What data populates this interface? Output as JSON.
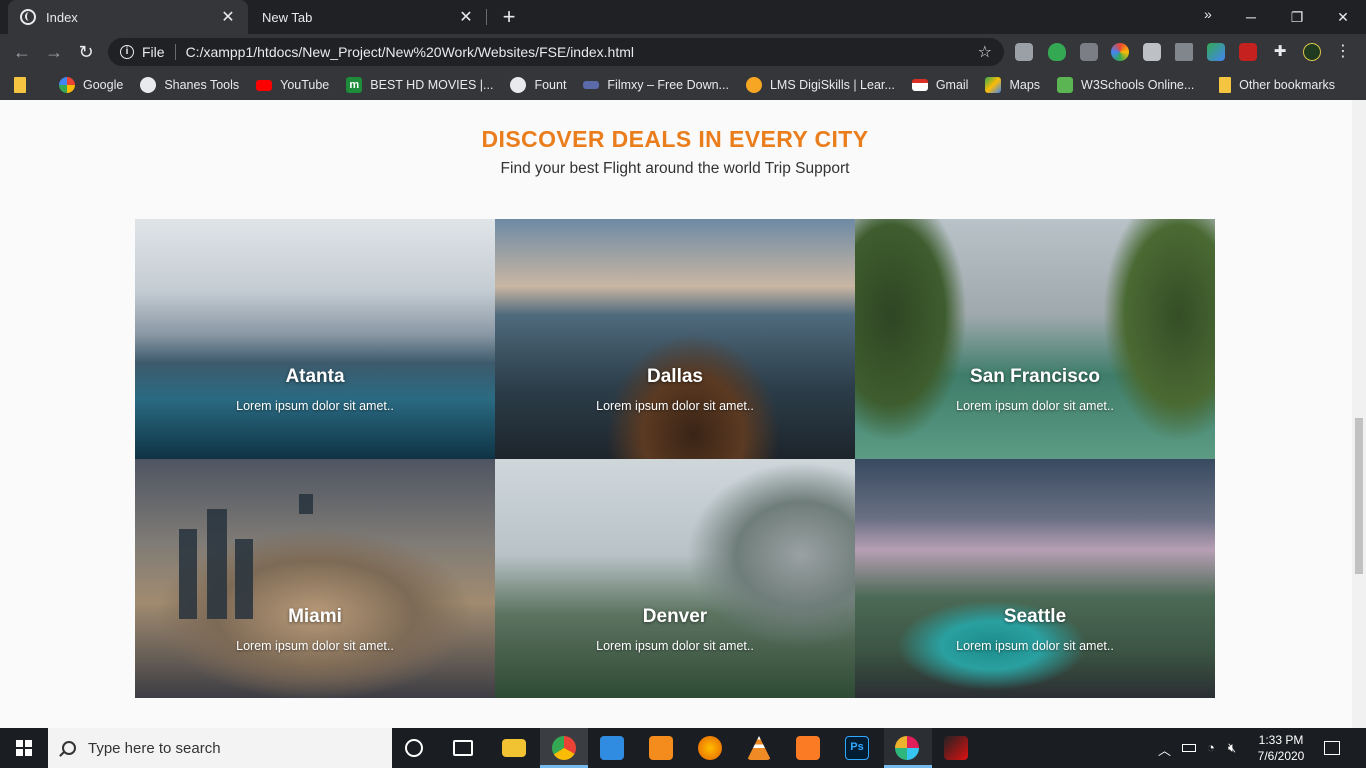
{
  "browser": {
    "tabs": [
      {
        "label": "Index",
        "active": true
      },
      {
        "label": "New Tab",
        "active": false
      }
    ],
    "address": {
      "scheme_label": "File",
      "url": "C:/xampp1/htdocs/New_Project/New%20Work/Websites/FSE/index.html"
    },
    "bookmarks": [
      {
        "label": "Google",
        "icon": "google-icon",
        "color": "#ffffff"
      },
      {
        "label": "Shanes Tools",
        "icon": "globe-icon",
        "color": "#e8eaed"
      },
      {
        "label": "YouTube",
        "icon": "youtube-icon",
        "color": "#ff0000"
      },
      {
        "label": "BEST HD MOVIES |...",
        "icon": "m-icon",
        "color": "#1e8c3a"
      },
      {
        "label": "Fount",
        "icon": "globe-icon",
        "color": "#e8eaed"
      },
      {
        "label": "Filmxy – Free Down...",
        "icon": "filmxy-icon",
        "color": "#5b6aa8"
      },
      {
        "label": "LMS DigiSkills | Lear...",
        "icon": "digiskills-icon",
        "color": "#f6a623"
      },
      {
        "label": "Gmail",
        "icon": "gmail-icon",
        "color": "#d93025"
      },
      {
        "label": "Maps",
        "icon": "maps-icon",
        "color": "#34a853"
      },
      {
        "label": "W3Schools Online...",
        "icon": "w3schools-icon",
        "color": "#5ab552"
      }
    ],
    "other_bookmarks": "Other bookmarks",
    "more_bookmarks": "»"
  },
  "page": {
    "heading": "DISCOVER DEALS IN EVERY CITY",
    "subheading": "Find your best Flight around the world Trip Support",
    "accent_color": "#ea7d1c",
    "cities": [
      {
        "name": "Atanta",
        "desc": "Lorem ipsum dolor sit amet.."
      },
      {
        "name": "Dallas",
        "desc": "Lorem ipsum dolor sit amet.."
      },
      {
        "name": "San Francisco",
        "desc": "Lorem ipsum dolor sit amet.."
      },
      {
        "name": "Miami",
        "desc": "Lorem ipsum dolor sit amet.."
      },
      {
        "name": "Denver",
        "desc": "Lorem ipsum dolor sit amet.."
      },
      {
        "name": "Seattle",
        "desc": "Lorem ipsum dolor sit amet.."
      }
    ]
  },
  "taskbar": {
    "search_placeholder": "Type here to search",
    "time": "1:33 PM",
    "date": "7/6/2020"
  }
}
